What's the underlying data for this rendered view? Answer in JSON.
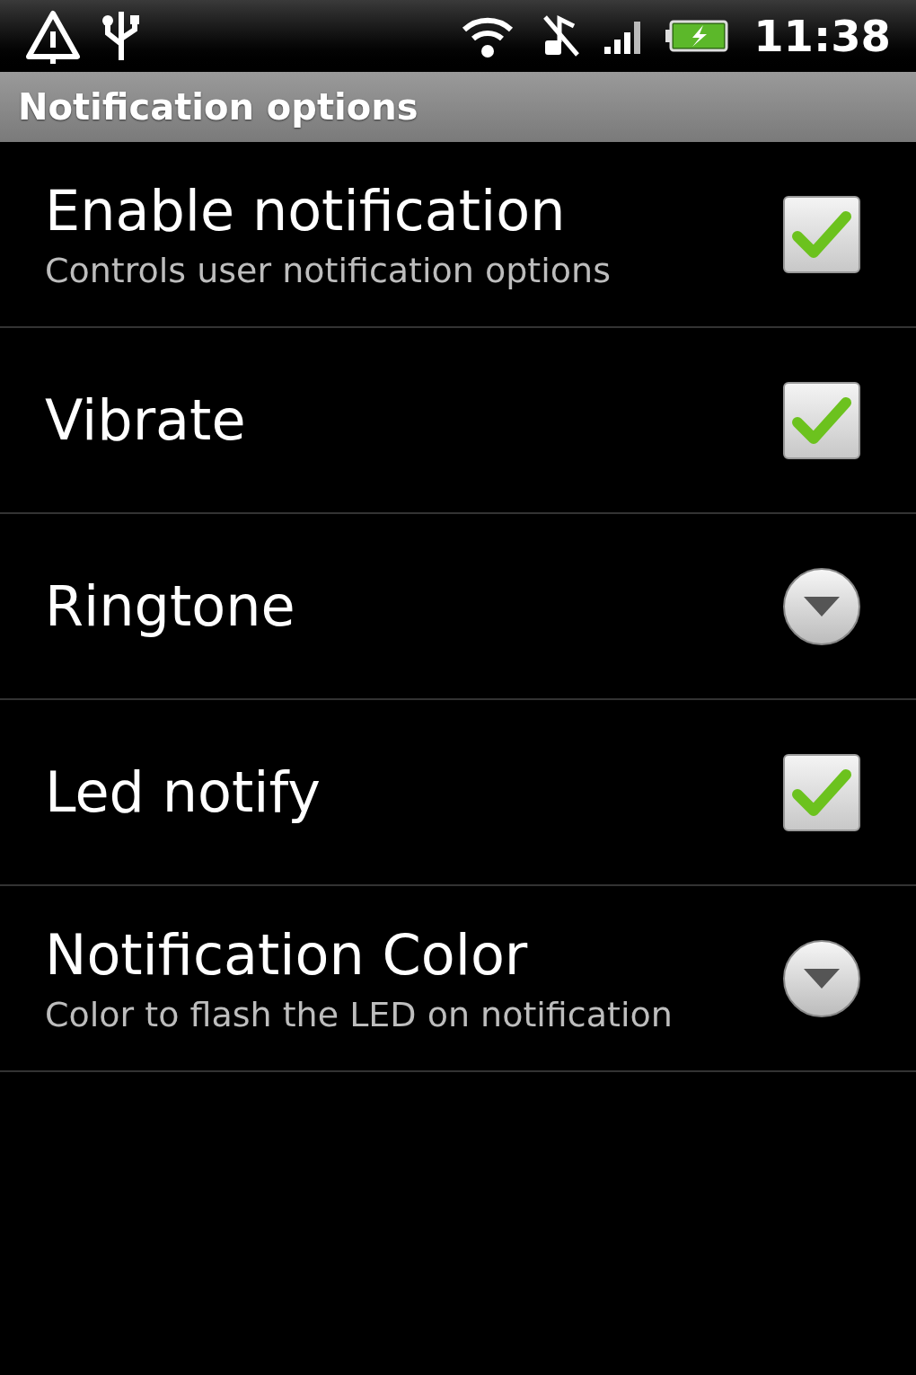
{
  "status_bar": {
    "time": "11:38"
  },
  "header": {
    "title": "Notification options"
  },
  "preferences": [
    {
      "kind": "checkbox",
      "title": "Enable notification",
      "summary": "Controls user notification options",
      "checked": true
    },
    {
      "kind": "checkbox",
      "title": "Vibrate",
      "checked": true
    },
    {
      "kind": "dropdown",
      "title": "Ringtone"
    },
    {
      "kind": "checkbox",
      "title": "Led notify",
      "checked": true
    },
    {
      "kind": "dropdown",
      "title": "Notification Color",
      "summary": "Color to flash the LED on notification"
    }
  ]
}
